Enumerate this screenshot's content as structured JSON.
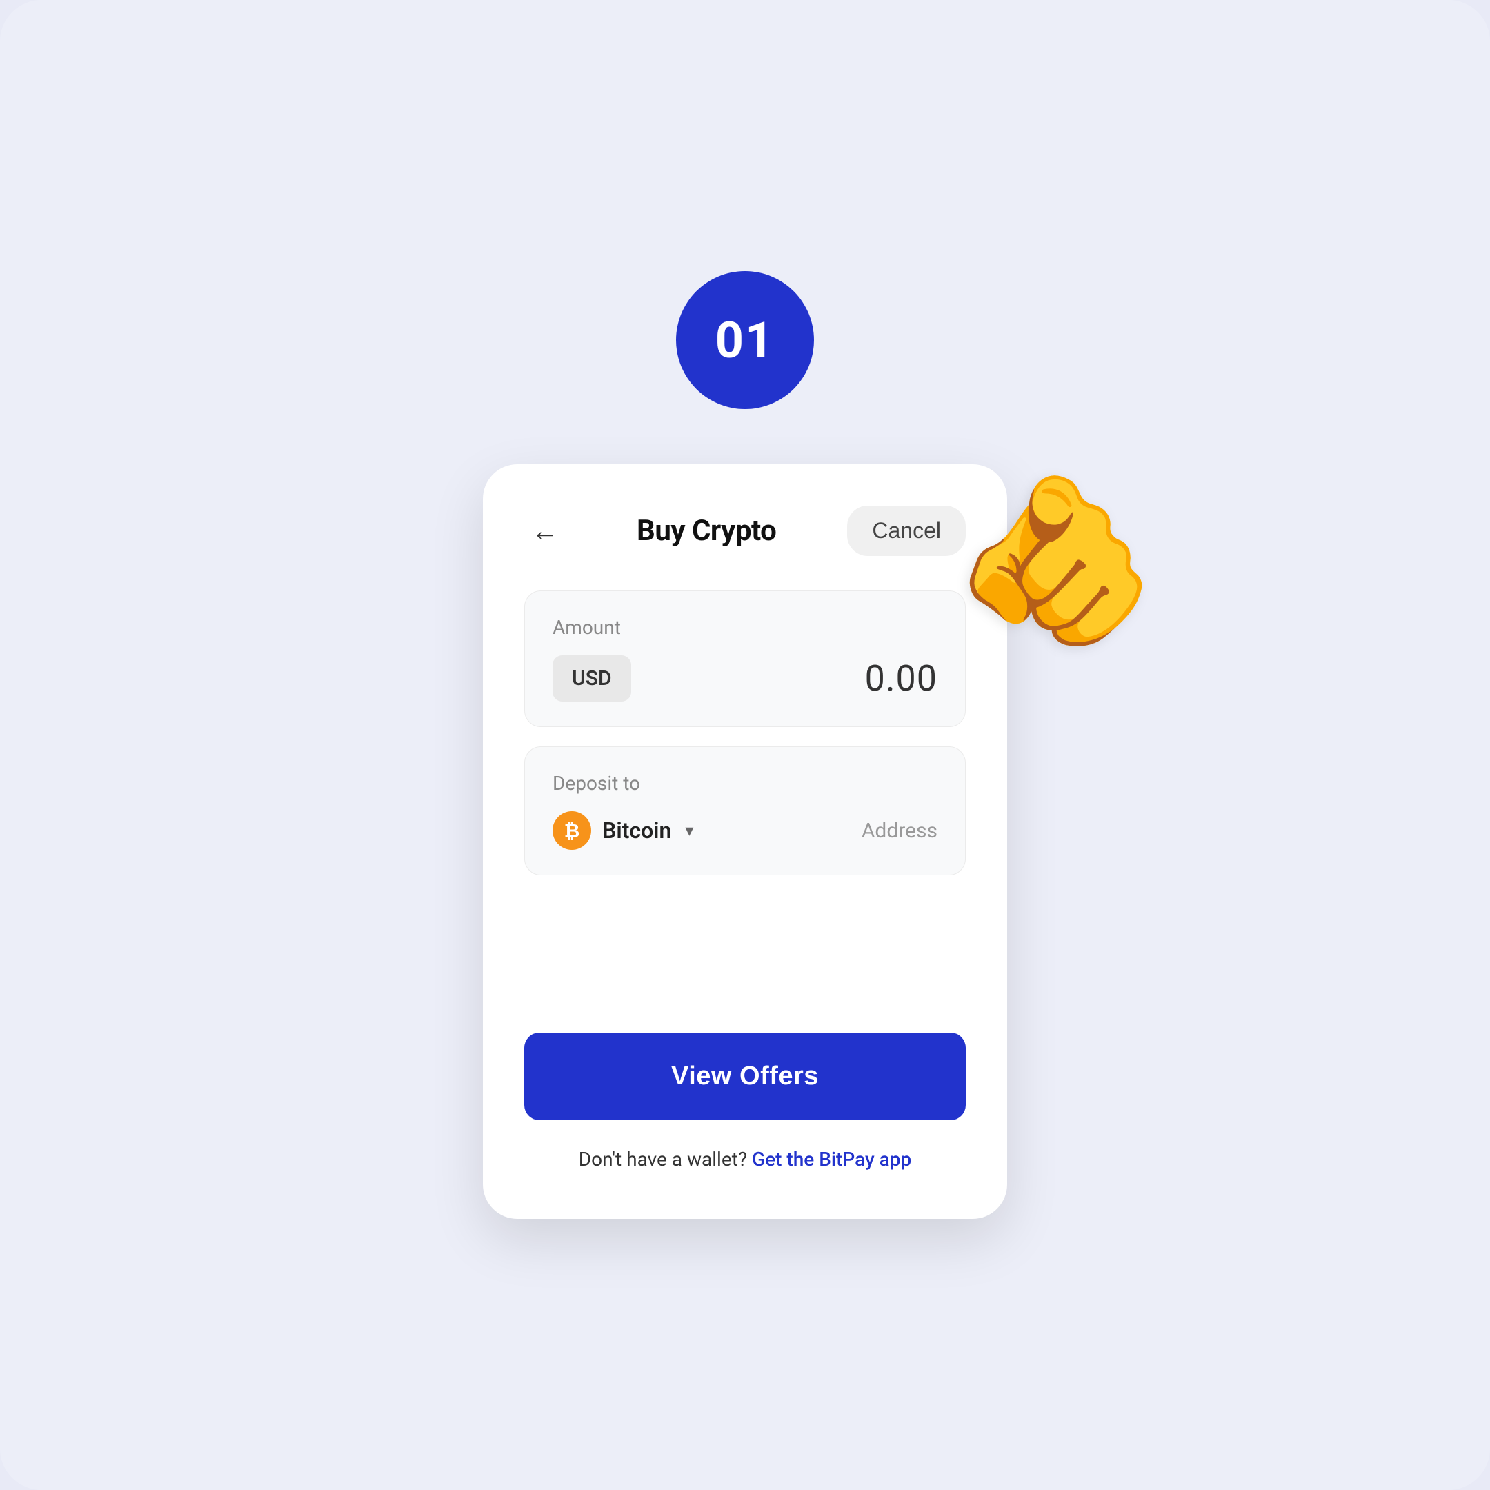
{
  "step": {
    "number": "01"
  },
  "header": {
    "title": "Buy Crypto",
    "cancel_label": "Cancel",
    "back_aria": "Back"
  },
  "amount_section": {
    "label": "Amount",
    "currency": "USD",
    "value": "0.00"
  },
  "deposit_section": {
    "label": "Deposit to",
    "crypto_name": "Bitcoin",
    "address_label": "Address"
  },
  "cta": {
    "view_offers": "View Offers"
  },
  "footer": {
    "no_wallet_text": "Don't have a wallet?",
    "bitpay_link": "Get the BitPay app"
  },
  "colors": {
    "accent": "#2233cc",
    "bitcoin_orange": "#f7931a"
  }
}
